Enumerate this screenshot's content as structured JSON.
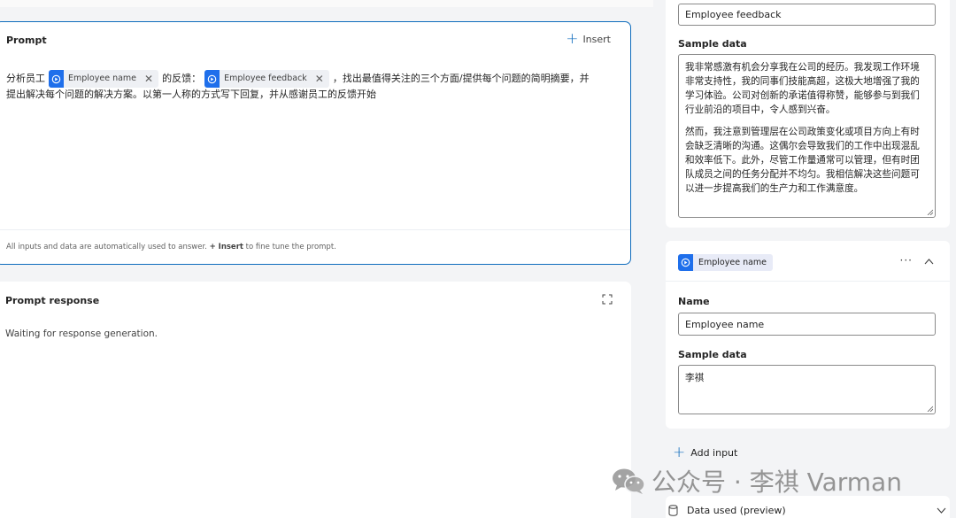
{
  "prompt": {
    "title": "Prompt",
    "insert_label": "Insert",
    "text_before": "分析员工",
    "chip_name": "Employee name",
    "text_between": "的反馈：",
    "chip_feedback": "Employee feedback",
    "text_after": "，找出最值得关注的三个方面/提供每个问题的简明摘要，并",
    "text_line2": "提出解决每个问题的解决方案。以第一人称的方式写下回复，并从感谢员工的反馈开始",
    "footer_prefix": "All inputs and data are automatically used to answer. ",
    "footer_insert": "+ Insert",
    "footer_suffix": " to fine tune the prompt."
  },
  "response": {
    "title": "Prompt response",
    "status": "Waiting for response generation."
  },
  "inputs": {
    "feedback": {
      "name_value": "Employee feedback",
      "sample_label": "Sample data",
      "sample_para1": "我非常感激有机会分享我在公司的经历。我发现工作环境非常支持性，我的同事们技能高超，这极大地增强了我的学习体验。公司对创新的承诺值得称赞，能够参与到我们行业前沿的项目中，令人感到兴奋。",
      "sample_para2": "然而，我注意到管理层在公司政策变化或项目方向上有时会缺乏清晰的沟通。这偶尔会导致我们的工作中出现混乱和效率低下。此外，尽管工作量通常可以管理，但有时团队成员之间的任务分配并不均匀。我相信解决这些问题可以进一步提高我们的生产力和工作满意度。"
    },
    "employee": {
      "tag": "Employee name",
      "name_label": "Name",
      "name_value": "Employee name",
      "sample_label": "Sample data",
      "sample_value": "李祺"
    },
    "add_input_label": "Add input",
    "data_used_label": "Data used (preview)"
  },
  "watermark": {
    "text": "公众号 · 李祺 Varman"
  },
  "colors": {
    "accent": "#0f6cbd",
    "chip_icon": "#1f6feb"
  }
}
